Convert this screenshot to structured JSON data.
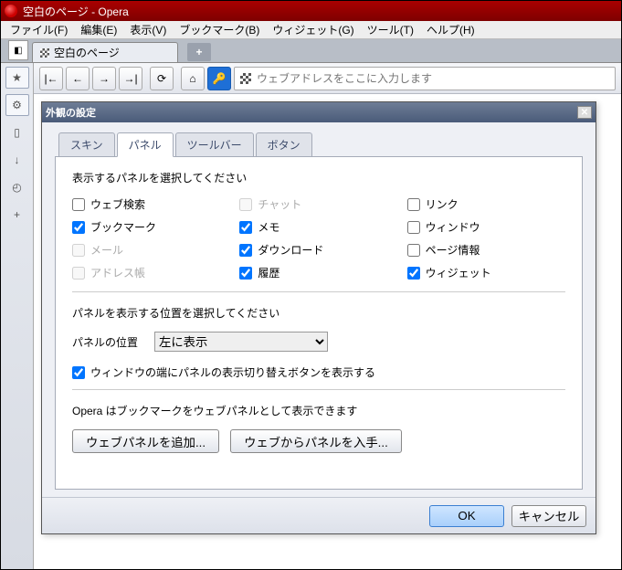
{
  "window": {
    "title": "空白のページ - Opera"
  },
  "menu": [
    "ファイル(F)",
    "編集(E)",
    "表示(V)",
    "ブックマーク(B)",
    "ウィジェット(G)",
    "ツール(T)",
    "ヘルプ(H)"
  ],
  "tab": {
    "label": "空白のページ"
  },
  "address": {
    "placeholder": "ウェブアドレスをここに入力します"
  },
  "sidebar_icons": [
    "star-icon",
    "gear-icon",
    "bookmark-icon",
    "arrow-down-icon",
    "clock-icon",
    "plus-icon"
  ],
  "toolbar_icons": [
    "first-icon",
    "back-icon",
    "forward-icon",
    "last-icon",
    "reload-icon",
    "home-icon",
    "key-icon"
  ],
  "dialog": {
    "title": "外観の設定",
    "tabs": [
      "スキン",
      "パネル",
      "ツールバー",
      "ボタン"
    ],
    "active_tab": 1,
    "section1": "表示するパネルを選択してください",
    "checkboxes": [
      {
        "label": "ウェブ検索",
        "checked": false,
        "disabled": false
      },
      {
        "label": "チャット",
        "checked": false,
        "disabled": true
      },
      {
        "label": "リンク",
        "checked": false,
        "disabled": false
      },
      {
        "label": "ブックマーク",
        "checked": true,
        "disabled": false
      },
      {
        "label": "メモ",
        "checked": true,
        "disabled": false
      },
      {
        "label": "ウィンドウ",
        "checked": false,
        "disabled": false
      },
      {
        "label": "メール",
        "checked": false,
        "disabled": true
      },
      {
        "label": "ダウンロード",
        "checked": true,
        "disabled": false
      },
      {
        "label": "ページ情報",
        "checked": false,
        "disabled": false
      },
      {
        "label": "アドレス帳",
        "checked": false,
        "disabled": true
      },
      {
        "label": "履歴",
        "checked": true,
        "disabled": false
      },
      {
        "label": "ウィジェット",
        "checked": true,
        "disabled": false
      }
    ],
    "section2": "パネルを表示する位置を選択してください",
    "position_label": "パネルの位置",
    "position_value": "左に表示",
    "toggle_checkbox": {
      "label": "ウィンドウの端にパネルの表示切り替えボタンを表示する",
      "checked": true
    },
    "section3": "Opera はブックマークをウェブパネルとして表示できます",
    "btn_add": "ウェブパネルを追加...",
    "btn_get": "ウェブからパネルを入手...",
    "ok": "OK",
    "cancel": "キャンセル"
  }
}
